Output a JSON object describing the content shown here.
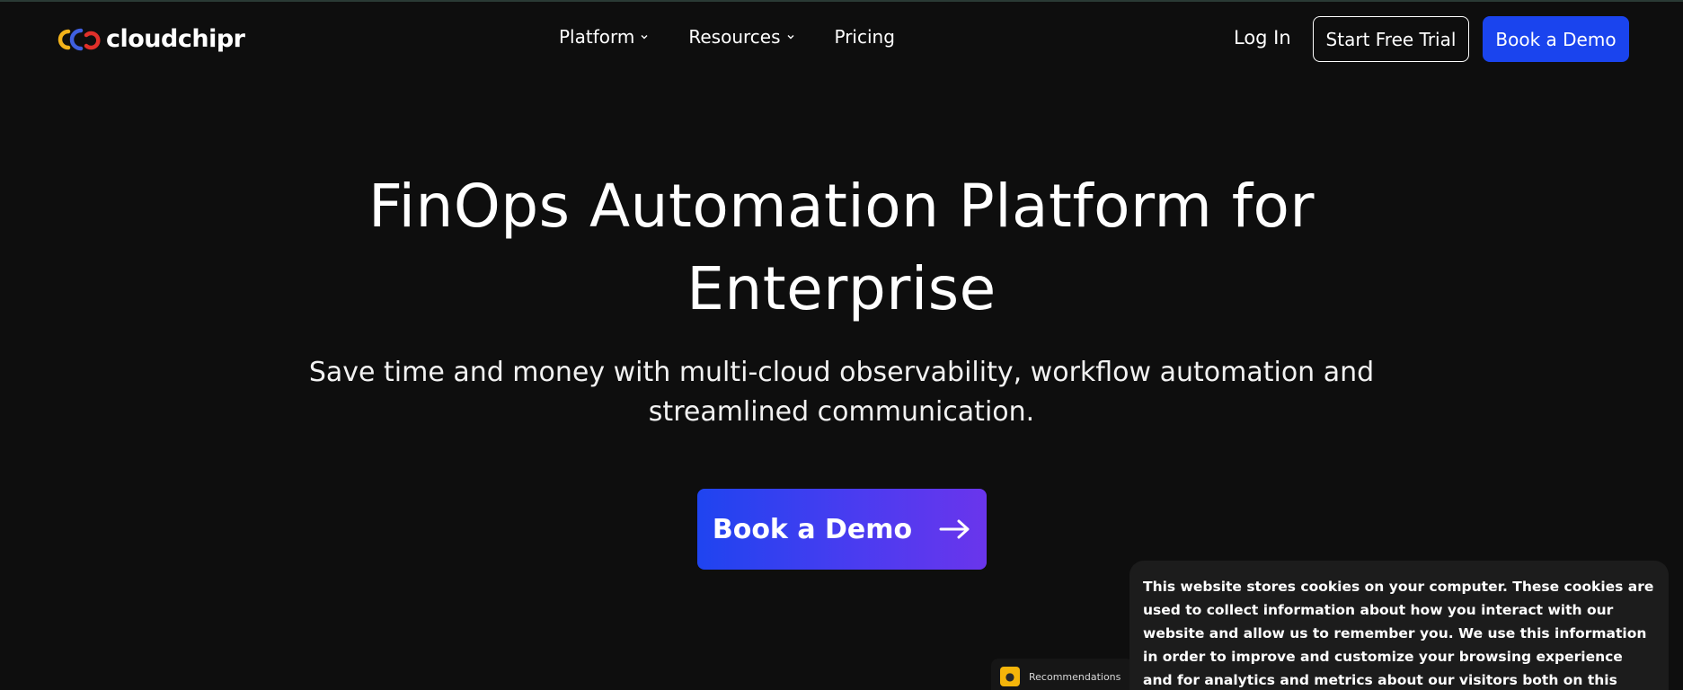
{
  "header": {
    "logo_text": "cloudchipr",
    "nav": [
      {
        "label": "Platform",
        "has_dropdown": true
      },
      {
        "label": "Resources",
        "has_dropdown": true
      },
      {
        "label": "Pricing",
        "has_dropdown": false
      }
    ],
    "login_label": "Log In",
    "trial_label": "Start Free Trial",
    "demo_label": "Book a Demo"
  },
  "hero": {
    "title": "FinOps Automation Platform for Enterprise",
    "subtitle": "Save time and money with multi-cloud observability, workflow automation and streamlined communication.",
    "cta_label": "Book a Demo"
  },
  "recommendations": {
    "label": "Recommendations"
  },
  "cookie_banner": {
    "text": "This website stores cookies on your computer. These cookies are used to collect information about how you interact with our website and allow us to remember you. We use this information in order to improve and customize your browsing experience and for analytics and metrics about our visitors both on this website and other media. To find out more about the cookies"
  },
  "colors": {
    "background": "#0e0e0e",
    "primary_button": "#1a44ee",
    "gradient_start": "#1f44f0",
    "gradient_end": "#6a35ec",
    "cookie_bg": "#1c1c1c",
    "reco_icon": "#f5b50a"
  },
  "icons": {
    "logo": "cloudchipr-logo-icon",
    "dropdown": "chevron-down-icon",
    "cta_arrow": "arrow-right-icon",
    "recommendations": "lightbulb-icon"
  }
}
